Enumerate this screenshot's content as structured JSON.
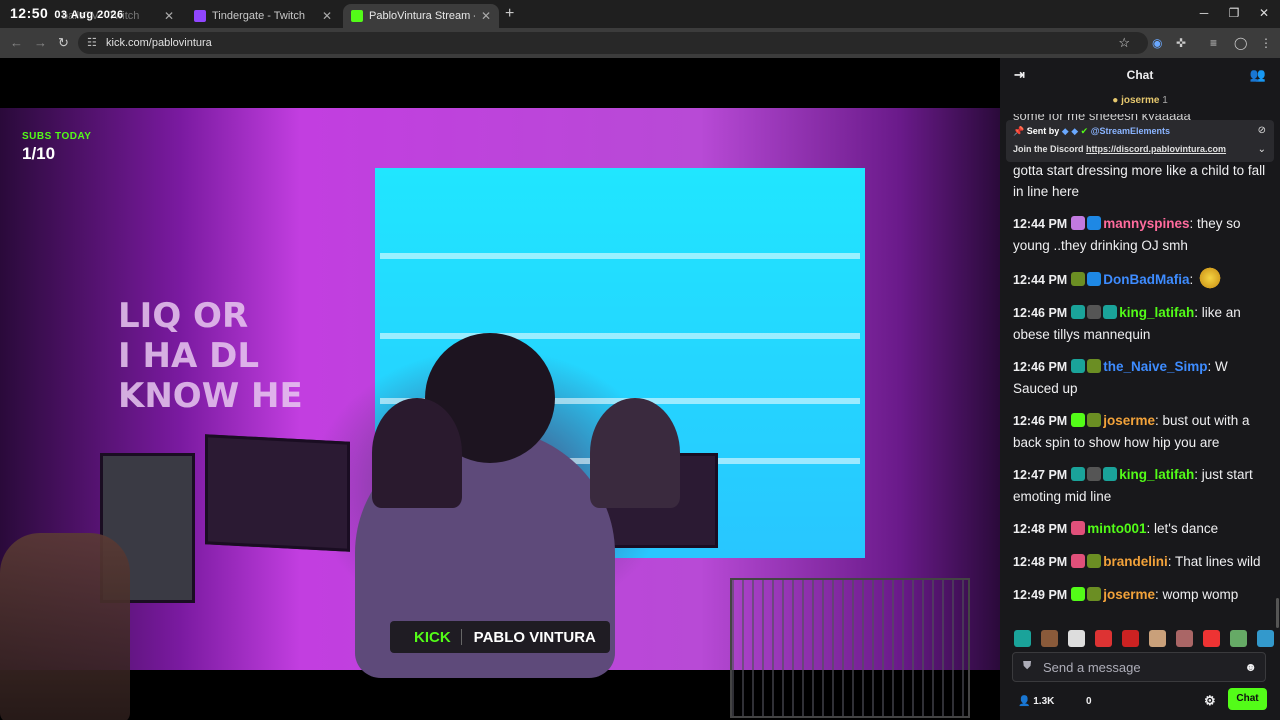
{
  "clock": {
    "time": "12:50",
    "date": "03 Aug 2026"
  },
  "tabs": [
    {
      "title": "ballsTV · Twitch",
      "favicon_color": "#9146ff"
    },
    {
      "title": "Tindergate - Twitch",
      "favicon_color": "#9146ff"
    },
    {
      "title": "PabloVintura Stream - Watch",
      "favicon_color": "#53fc18"
    }
  ],
  "window_controls": {
    "minimize": "─",
    "restore": "❐",
    "close": "✕"
  },
  "address": {
    "url": "kick.com/pablovintura"
  },
  "video": {
    "subs_label": "SUBS TODAY",
    "subs_count": "1/10",
    "overlay_brand": "KICK",
    "overlay_name": "PABLO VINTURA",
    "wall_text": "LIQ OR\nI HA DL\nKNOW HE"
  },
  "chat": {
    "title": "Chat",
    "pinned_user": "joserme",
    "pinned_user_count": "1",
    "cut_line": "some for me sheeesh kyaaaaa",
    "pinned": {
      "sent_by_label": "Sent by",
      "sender": "@StreamElements",
      "message": "Join the Discord",
      "link": "https://discord.pablovintura.com"
    },
    "messages": [
      {
        "time": "",
        "user": "",
        "user_color": "#efeff1",
        "text": "gotta start dressing more like a child to fall in line here",
        "badges": []
      },
      {
        "time": "12:44 PM",
        "user": "mannyspines",
        "user_color": "#ff6b9d",
        "text": "they so young ..they drinking OJ smh",
        "badges": [
          "#c27ae0",
          "#1e88e5"
        ]
      },
      {
        "time": "12:44 PM",
        "user": "DonBadMafia",
        "user_color": "#3e8cff",
        "text": "",
        "badges": [
          "#6b8e23",
          "#1e88e5"
        ],
        "emote": true
      },
      {
        "time": "12:46 PM",
        "user": "king_latifah",
        "user_color": "#53fc18",
        "text": "like an obese tillys mannequin",
        "badges": [
          "#1aa39a",
          "#555",
          "#1aa39a"
        ]
      },
      {
        "time": "12:46 PM",
        "user": "the_Naive_Simp",
        "user_color": "#3e8cff",
        "text": "W Sauced up",
        "badges": [
          "#1aa39a",
          "#6b8e23"
        ]
      },
      {
        "time": "12:46 PM",
        "user": "joserme",
        "user_color": "#f2a23a",
        "text": "bust out with a back spin to show how hip you are",
        "badges": [
          "#53fc18",
          "#6b8e23"
        ]
      },
      {
        "time": "12:47 PM",
        "user": "king_latifah",
        "user_color": "#53fc18",
        "text": "just start emoting mid line",
        "badges": [
          "#1aa39a",
          "#555",
          "#1aa39a"
        ]
      },
      {
        "time": "12:48 PM",
        "user": "minto001",
        "user_color": "#53fc18",
        "text": "let's dance",
        "badges": [
          "#e0507a"
        ]
      },
      {
        "time": "12:48 PM",
        "user": "brandelini",
        "user_color": "#f2a23a",
        "text": "That lines wild",
        "badges": [
          "#e0507a",
          "#6b8e23"
        ]
      },
      {
        "time": "12:49 PM",
        "user": "joserme",
        "user_color": "#f2a23a",
        "text": "womp womp",
        "badges": [
          "#53fc18",
          "#6b8e23"
        ]
      }
    ],
    "input_placeholder": "Send a message",
    "viewers": "1.3K",
    "zero_count": "0",
    "chat_button": "Chat",
    "accent": "#53fc18"
  }
}
